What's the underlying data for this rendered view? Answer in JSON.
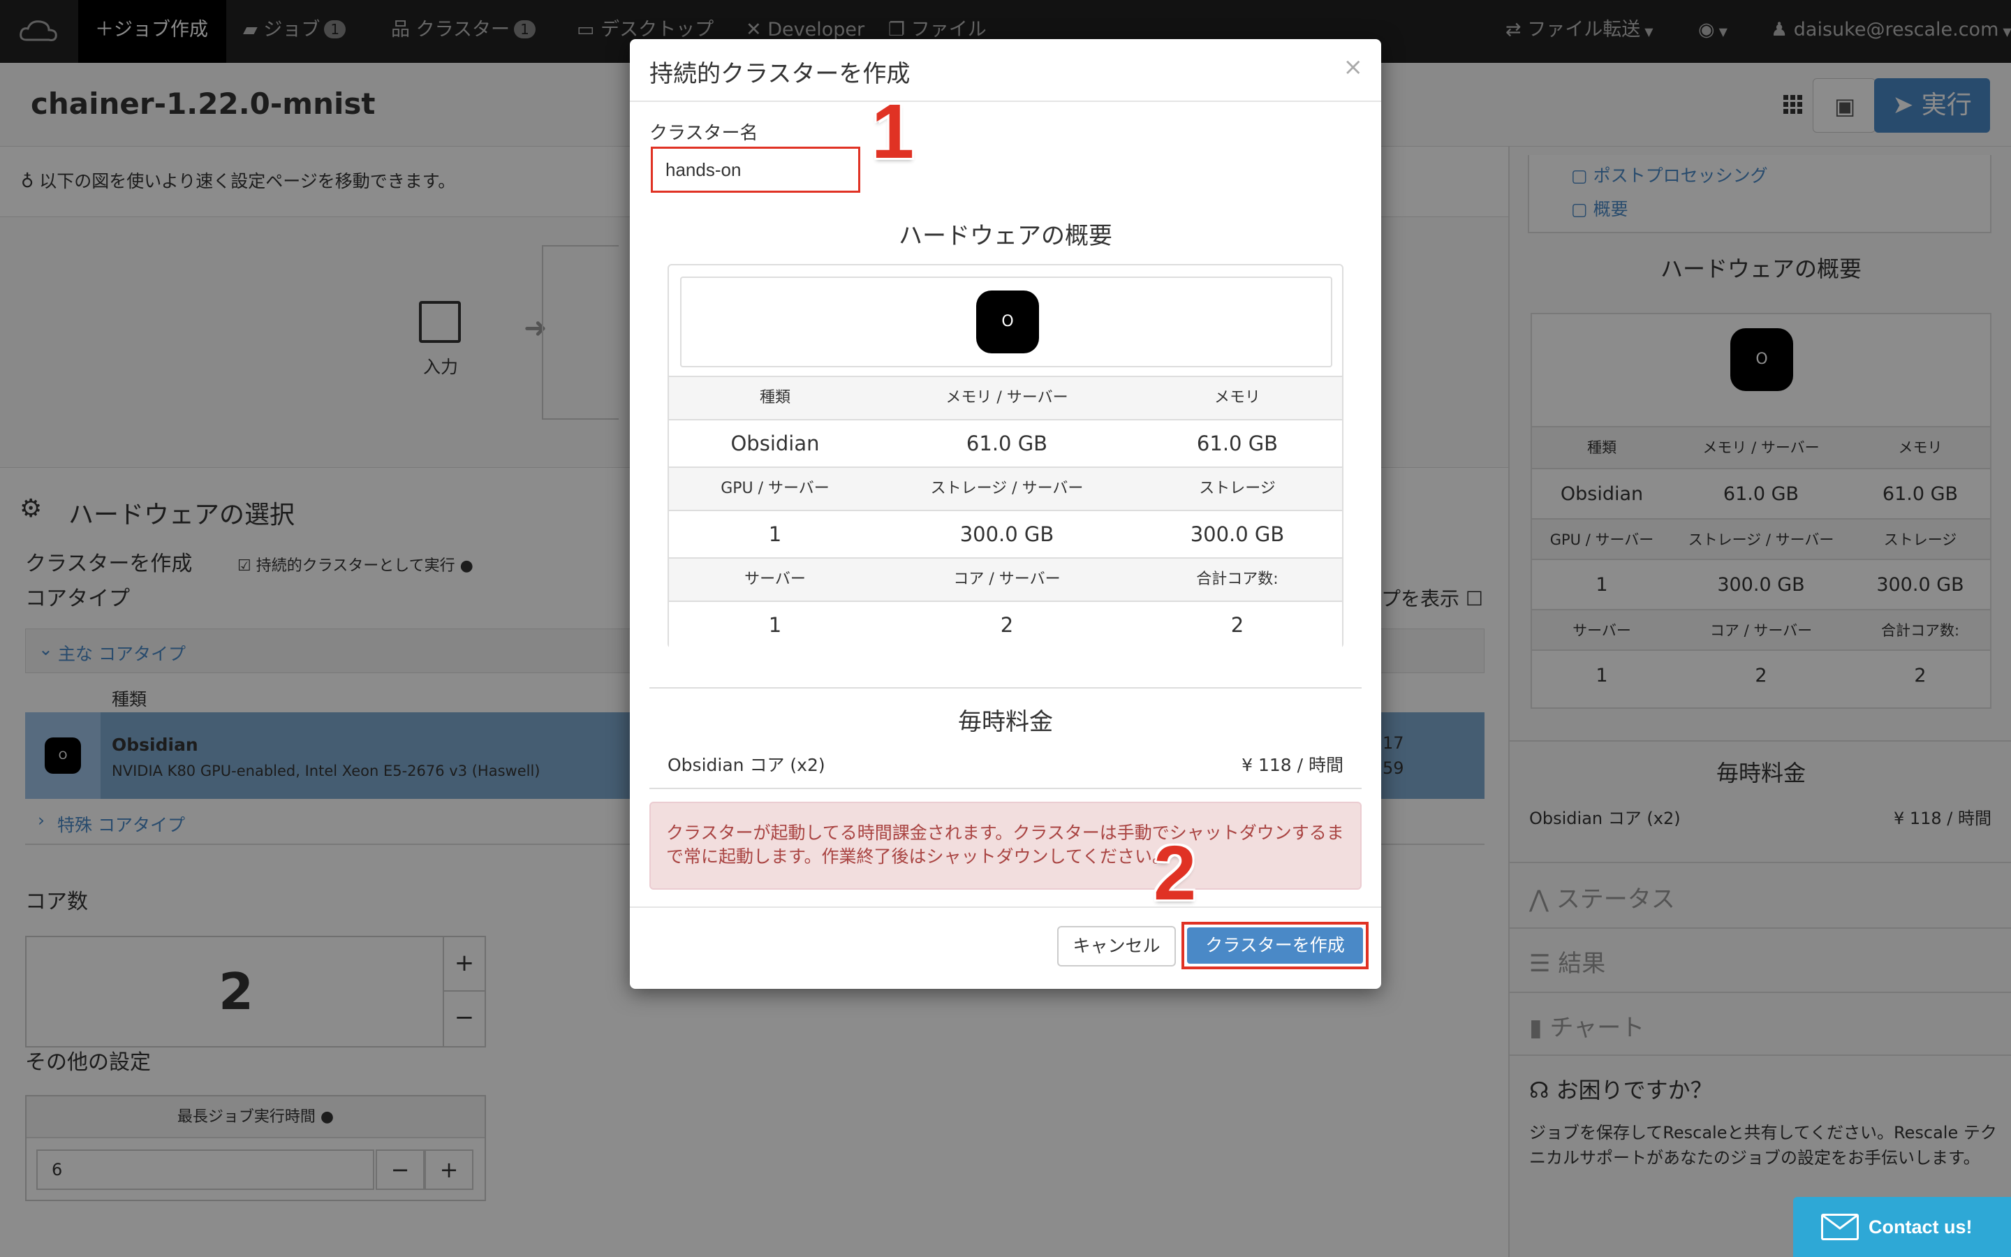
{
  "navbar": {
    "create_job": "ジョブ作成",
    "jobs": "ジョブ",
    "jobs_count": "1",
    "clusters": "クラスター",
    "clusters_count": "1",
    "desktop": "デスクトップ",
    "developer": "Developer",
    "files": "ファイル",
    "file_transfer": "ファイル転送",
    "user": "daisuke@rescale.com"
  },
  "job": {
    "title": "chainer-1.22.0-mnist",
    "run_label": "実行"
  },
  "page": {
    "hint": "以下の図を使いより速く設定ページを移動できます。",
    "flow_input": "入力",
    "hw_section": "ハードウェアの選択",
    "create_cluster": "クラスターを作成",
    "persistent_checkbox": "持続的クラスターとして実行",
    "core_type": "コアタイプ",
    "show_label": "プを表示",
    "main_core_types": "主な コアタイプ",
    "col_type": "種類",
    "sel_name": "Obsidian",
    "sel_desc": "NVIDIA K80 GPU-enabled, Intel Xeon E5-2676 v3 (Haswell)",
    "sel_tail1": "17",
    "sel_tail2": "59",
    "special_core_types": "特殊 コアタイプ",
    "core_count_label": "コア数",
    "core_count": "2",
    "other_settings": "その他の設定",
    "max_runtime": "最長ジョブ実行時間",
    "max_runtime_value": "6"
  },
  "sidebar": {
    "post_processing": "ポストプロセッシング",
    "overview": "概要",
    "hw_title": "ハードウェアの概要",
    "hourly": "毎時料金",
    "price_label": "Obsidian コア (x2)",
    "price_value": "¥ 118 / 時間",
    "status": "ステータス",
    "results": "結果",
    "charts": "チャート",
    "help_title": "お困りですか？",
    "help_text": "ジョブを保存してRescaleと共有してください。Rescale テクニカルサポートがあなたのジョブの設定をお手伝いします。"
  },
  "hw": {
    "icon_letter": "O",
    "head1": [
      "種類",
      "メモリ / サーバー",
      "メモリ"
    ],
    "row1": [
      "Obsidian",
      "61.0 GB",
      "61.0 GB"
    ],
    "head2": [
      "GPU / サーバー",
      "ストレージ / サーバー",
      "ストレージ"
    ],
    "row2": [
      "1",
      "300.0 GB",
      "300.0 GB"
    ],
    "head3": [
      "サーバー",
      "コア / サーバー",
      "合計コア数:"
    ],
    "row3": [
      "1",
      "2",
      "2"
    ]
  },
  "modal": {
    "title": "持続的クラスターを作成",
    "close": "×",
    "name_label": "クラスター名",
    "name_value": "hands-on",
    "hw_title": "ハードウェアの概要",
    "hourly_title": "毎時料金",
    "price_label": "Obsidian コア (x2)",
    "price_value": "¥ 118 / 時間",
    "alert": "クラスターが起動してる時間課金されます。クラスターは手動でシャットダウンするまで常に起動します。作業終了後はシャットダウンしてください。",
    "cancel": "キャンセル",
    "create": "クラスターを作成",
    "annot1": "1",
    "annot2": "2"
  },
  "contact": "Contact us!",
  "colors": {
    "accent": "#4a89c7",
    "annotation": "#e03224",
    "navbar": "#222222"
  }
}
